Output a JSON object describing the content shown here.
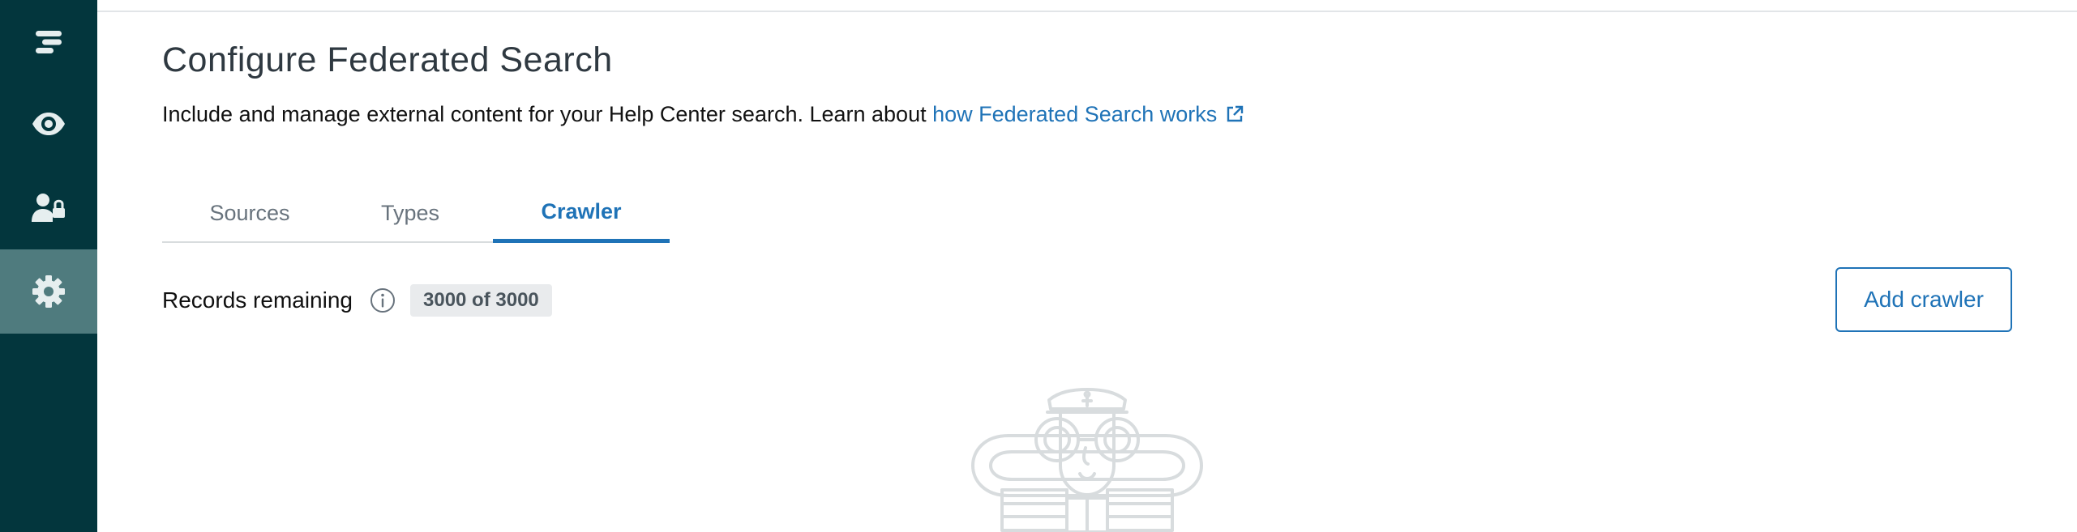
{
  "sidebar": {
    "items": [
      {
        "name": "overview",
        "icon": "stack-icon",
        "active": false
      },
      {
        "name": "preview",
        "icon": "eye-icon",
        "active": false
      },
      {
        "name": "user-permissions",
        "icon": "user-lock-icon",
        "active": false
      },
      {
        "name": "settings",
        "icon": "gear-icon",
        "active": true
      }
    ],
    "colors": {
      "background": "#03363d",
      "active": "#4f7b7e",
      "icon": "#e6eeef"
    }
  },
  "header": {
    "title": "Configure Federated Search",
    "intro_text": "Include and manage external content for your Help Center search. Learn about ",
    "link_text": "how Federated Search works",
    "link_icon": "external-link-icon"
  },
  "tabs": [
    {
      "label": "Sources",
      "active": false
    },
    {
      "label": "Types",
      "active": false
    },
    {
      "label": "Crawler",
      "active": true
    }
  ],
  "records": {
    "label": "Records remaining",
    "info_icon": "info-icon",
    "badge": "3000 of 3000"
  },
  "actions": {
    "add_crawler_label": "Add crawler"
  },
  "empty_state": {
    "illustration": "sailor-with-binoculars-illustration"
  },
  "colors": {
    "accent": "#1f73b7",
    "text": "#2f3941",
    "muted": "#68737d"
  }
}
